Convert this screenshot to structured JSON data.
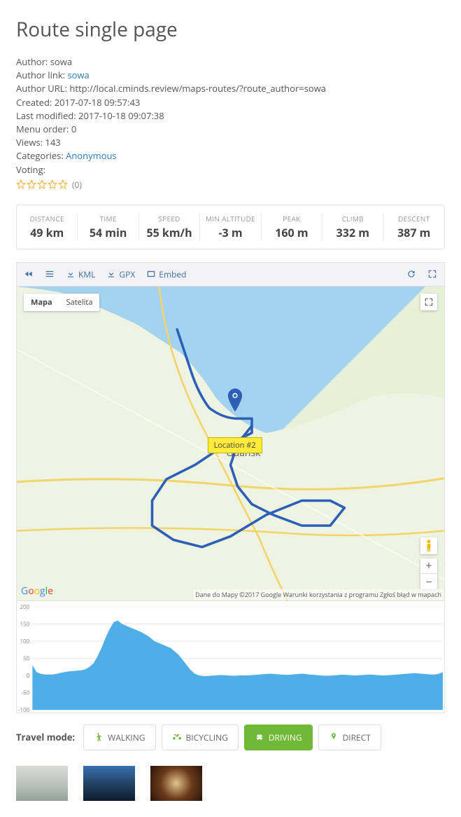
{
  "title": "Route single page",
  "meta": {
    "author_label": "Author: ",
    "author": "sowa",
    "author_link_label": "Author link: ",
    "author_link": "sowa",
    "author_url_label": "Author URL: ",
    "author_url": "http://local.cminds.review/maps-routes/?route_author=sowa",
    "created_label": "Created: ",
    "created": "2017-07-18 09:57:43",
    "modified_label": "Last modified: ",
    "modified": "2017-10-18 09:07:38",
    "menu_order_label": "Menu order: ",
    "menu_order": "0",
    "views_label": "Views: ",
    "views": "143",
    "categories_label": "Categories: ",
    "categories": "Anonymous",
    "voting_label": "Voting:",
    "vote_count": "(0)"
  },
  "stats": [
    {
      "label": "DISTANCE",
      "value": "49 km"
    },
    {
      "label": "TIME",
      "value": "54 min"
    },
    {
      "label": "SPEED",
      "value": "55 km/h"
    },
    {
      "label": "MIN ALTITUDE",
      "value": "-3 m"
    },
    {
      "label": "PEAK",
      "value": "160 m"
    },
    {
      "label": "CLIMB",
      "value": "332 m"
    },
    {
      "label": "DESCENT",
      "value": "387 m"
    }
  ],
  "toolbar": {
    "kml": "KML",
    "gpx": "GPX",
    "embed": "Embed"
  },
  "map": {
    "type_map": "Mapa",
    "type_sat": "Satelita",
    "location_label": "Location #2",
    "city": "Gdańsk",
    "attribution": "Dane do Mapy ©2017 Google  Warunki korzystania z programu    Zgłoś błąd w mapach",
    "zoom_in": "+",
    "zoom_out": "−"
  },
  "chart_data": {
    "type": "area",
    "title": "",
    "xlabel": "",
    "ylabel": "",
    "ylim": [
      -100,
      200
    ],
    "yticks": [
      -100,
      -50,
      0,
      50,
      100,
      150,
      200
    ],
    "x_range_km": [
      0,
      49
    ],
    "values": [
      30,
      10,
      5,
      3,
      3,
      3,
      5,
      8,
      10,
      12,
      13,
      14,
      15,
      18,
      25,
      35,
      55,
      80,
      110,
      135,
      155,
      160,
      150,
      145,
      140,
      135,
      130,
      125,
      118,
      110,
      100,
      95,
      90,
      85,
      80,
      70,
      60,
      45,
      30,
      15,
      5,
      0,
      -2,
      -2,
      -1,
      0,
      1,
      1,
      0,
      -1,
      -1,
      0,
      0,
      0,
      1,
      2,
      3,
      4,
      5,
      5,
      4,
      3,
      2,
      2,
      3,
      4,
      5,
      5,
      3,
      2,
      1,
      0,
      -1,
      -1,
      0,
      1,
      2,
      2,
      1,
      0,
      0,
      1,
      2,
      3,
      2,
      1,
      0,
      0,
      1,
      2,
      3,
      4,
      5,
      6,
      7,
      6,
      5,
      4,
      3,
      3,
      5,
      10
    ]
  },
  "travel": {
    "label": "Travel mode:",
    "walking": "WALKING",
    "bicycling": "BICYCLING",
    "driving": "DRIVING",
    "direct": "DIRECT"
  }
}
